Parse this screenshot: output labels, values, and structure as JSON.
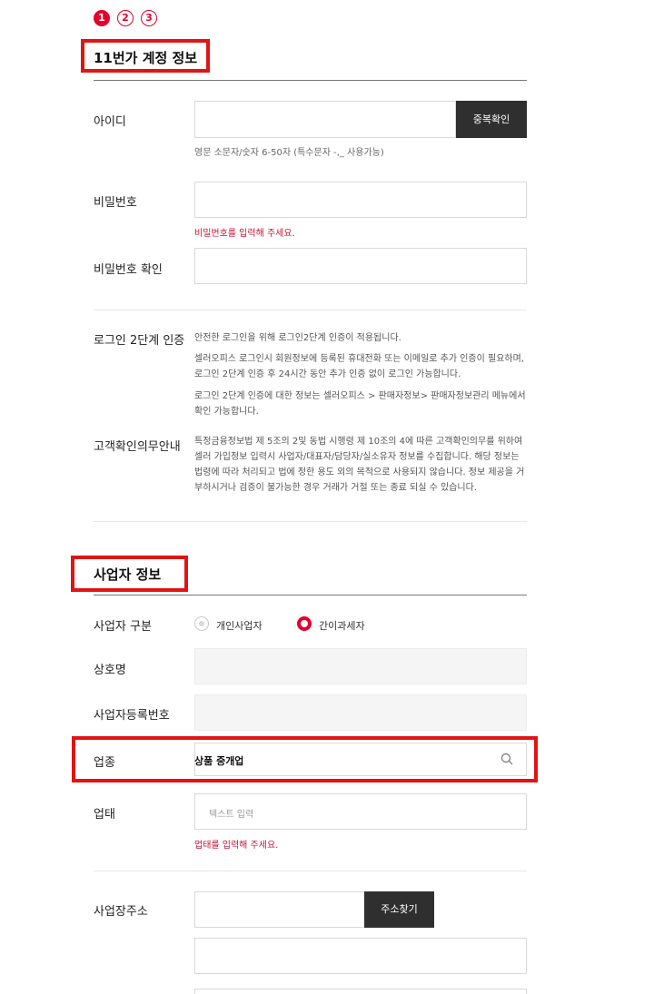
{
  "steps": [
    "1",
    "2",
    "3"
  ],
  "account": {
    "title": "11번가 계정 정보",
    "id_label": "아이디",
    "id_value": "",
    "dup_check_button": "중복확인",
    "id_help": "영문 소문자/숫자 6-50자 (특수문자 -,_ 사용가능)",
    "pw_label": "비밀번호",
    "pw_value": "",
    "pw_error": "비밀번호를 입력해 주세요.",
    "pw_confirm_label": "비밀번호 확인",
    "pw_confirm_value": "",
    "two_factor_label": "로그인 2단계 인증",
    "two_factor_text_1": "안전한 로그인을 위해 로그인2단계 인증이 적용됩니다.",
    "two_factor_text_2": "셀러오피스 로그인시 회원정보에 등록된 휴대전화 또는 이메일로 추가 인증이 필요하며,로그인 2단계 인증 후 24시간 동안 추가 인증 없이 로그인 가능합니다.",
    "two_factor_text_3": "로그인 2단계 인증에 대한 정보는 셀러오피스 > 판매자정보> 판매자정보관리 메뉴에서 확인 가능합니다.",
    "kyc_label": "고객확인의무안내",
    "kyc_text": "특정금융정보법 제 5조의 2및 동법 시행령 제 10조의 4에 따른 고객확인의무를 위하여 셀러 가입정보 입력시 사업자/대표자/담당자/실소유자 정보를 수집합니다. 해당 정보는 법령에 따라 처리되고 법에 정한 용도 외의 목적으로 사용되지 않습니다. 정보 제공을 거부하시거나 검증이 불가능한 경우 거래가 거절 또는 종료 되실 수 있습니다."
  },
  "business": {
    "title": "사업자 정보",
    "type_label": "사업자 구분",
    "type_options": [
      "개인사업자",
      "간이과세자"
    ],
    "type_selected": "간이과세자",
    "company_label": "상호명",
    "company_value": "",
    "regno_label": "사업자등록번호",
    "regno_value": "",
    "industry_label": "업종",
    "industry_value": "상품 중개업",
    "category_label": "업태",
    "category_placeholder": "텍스트 입력",
    "category_error": "업태를 입력해 주세요.",
    "address_label": "사업장주소",
    "address_button": "주소찾기",
    "address_zip": "",
    "address_line1": "",
    "address_line2": ""
  },
  "colors": {
    "accent": "#e4002b",
    "highlight": "#e01414",
    "button": "#2f2f2f",
    "error": "#c4153c"
  }
}
